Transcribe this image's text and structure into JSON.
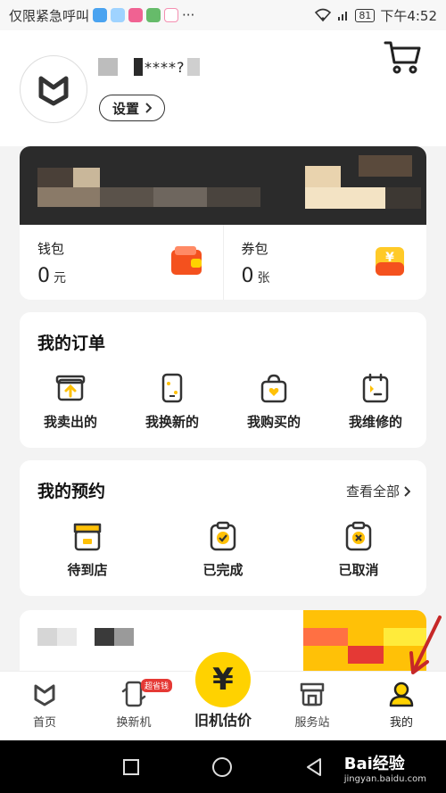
{
  "status_bar": {
    "carrier_text": "仅限紧急呼叫",
    "more": "···",
    "battery": "81",
    "time": "下午4:52"
  },
  "profile": {
    "username_masked": "****?",
    "settings_label": "设置"
  },
  "wallet": {
    "wallet_label": "钱包",
    "wallet_value": "0",
    "wallet_unit": "元",
    "coupon_label": "券包",
    "coupon_value": "0",
    "coupon_unit": "张"
  },
  "orders": {
    "title": "我的订单",
    "items": [
      {
        "label": "我卖出的",
        "icon": "box-upload-icon"
      },
      {
        "label": "我换新的",
        "icon": "phone-swap-icon"
      },
      {
        "label": "我购买的",
        "icon": "shopping-bag-icon"
      },
      {
        "label": "我维修的",
        "icon": "repair-clipboard-icon"
      }
    ]
  },
  "appointments": {
    "title": "我的预约",
    "view_all": "查看全部",
    "items": [
      {
        "label": "待到店",
        "icon": "store-icon"
      },
      {
        "label": "已完成",
        "icon": "clipboard-check-icon"
      },
      {
        "label": "已取消",
        "icon": "clipboard-cancel-icon"
      }
    ]
  },
  "tabbar": {
    "tabs": [
      {
        "label": "首页",
        "icon": "home-heart-icon"
      },
      {
        "label": "换新机",
        "icon": "phone-icon",
        "badge": "超省钱"
      },
      {
        "label": "旧机估价",
        "icon": "yuan-icon",
        "center_symbol": "¥"
      },
      {
        "label": "服务站",
        "icon": "shop-icon"
      },
      {
        "label": "我的",
        "icon": "user-icon"
      }
    ]
  },
  "watermark": {
    "text": "Bai经验",
    "sub": "jingyan.baidu.com"
  },
  "colors": {
    "accent": "#ffd200",
    "icon_dark": "#333333",
    "badge_red": "#e53935"
  }
}
